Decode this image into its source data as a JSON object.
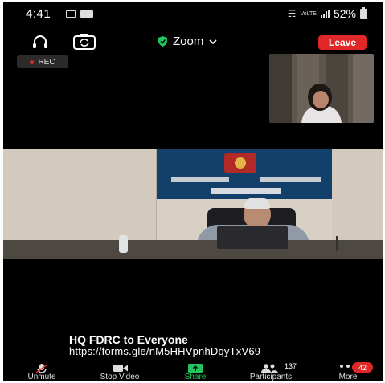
{
  "status_bar": {
    "time": "4:41",
    "network": "VoLTE",
    "battery": "52%"
  },
  "meeting": {
    "title": "Zoom",
    "leave_label": "Leave",
    "rec_label": "REC"
  },
  "chat": {
    "sender": "HQ FDRC to Everyone",
    "message": "https://forms.gle/nM5HHVpnhDqyTxV69"
  },
  "toolbar": {
    "unmute": "Unmute",
    "stop_video": "Stop Video",
    "share": "Share",
    "participants": "Participants",
    "participants_count": "137",
    "more": "More",
    "more_badge": "42"
  },
  "colors": {
    "leave": "#e02828",
    "share_accent": "#22c55e",
    "shield": "#22c55e"
  }
}
